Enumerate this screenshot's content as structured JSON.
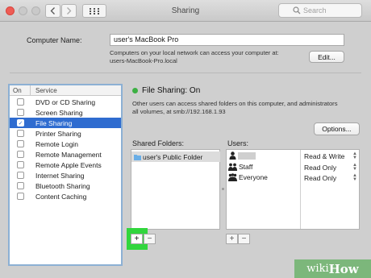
{
  "window": {
    "title": "Sharing",
    "search_placeholder": "Search"
  },
  "computer_name": {
    "label": "Computer Name:",
    "value": "user's MacBook Pro",
    "note_line1": "Computers on your local network can access your computer at:",
    "note_line2": "users-MacBook-Pro.local",
    "edit_label": "Edit..."
  },
  "services": {
    "header_on": "On",
    "header_service": "Service",
    "items": [
      {
        "label": "DVD or CD Sharing",
        "checked": false
      },
      {
        "label": "Screen Sharing",
        "checked": false
      },
      {
        "label": "File Sharing",
        "checked": true,
        "selected": true
      },
      {
        "label": "Printer Sharing",
        "checked": false
      },
      {
        "label": "Remote Login",
        "checked": false
      },
      {
        "label": "Remote Management",
        "checked": false
      },
      {
        "label": "Remote Apple Events",
        "checked": false
      },
      {
        "label": "Internet Sharing",
        "checked": false
      },
      {
        "label": "Bluetooth Sharing",
        "checked": false
      },
      {
        "label": "Content Caching",
        "checked": false
      }
    ]
  },
  "file_sharing": {
    "status": "File Sharing: On",
    "desc_line1": "Other users can access shared folders on this computer, and administrators",
    "desc_line2": "all volumes, at smb://192.168.1.93",
    "options_label": "Options...",
    "shared_folders_label": "Shared Folders:",
    "users_label": "Users:",
    "folders": [
      "user's Public Folder"
    ],
    "users": [
      {
        "name": "",
        "permission": "Read & Write"
      },
      {
        "name": "Staff",
        "permission": "Read Only"
      },
      {
        "name": "Everyone",
        "permission": "Read Only"
      }
    ],
    "add": "+",
    "remove": "−"
  },
  "watermark": {
    "part1": "wiki",
    "part2": "How"
  },
  "colors": {
    "selection": "#2f6cd0",
    "status_on": "#3cb043",
    "highlight": "#31d63d"
  }
}
